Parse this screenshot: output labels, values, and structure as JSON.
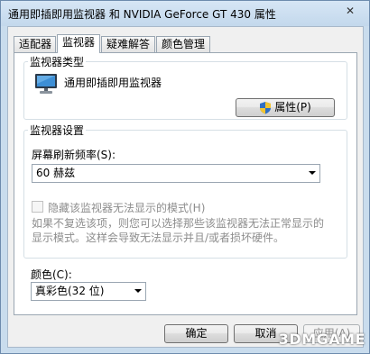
{
  "window": {
    "title": "通用即插即用监视器 和 NVIDIA GeForce GT 430 属性",
    "close_symbol": "✕"
  },
  "tabs": [
    {
      "label": "适配器",
      "active": false
    },
    {
      "label": "监视器",
      "active": true
    },
    {
      "label": "疑难解答",
      "active": false
    },
    {
      "label": "颜色管理",
      "active": false
    }
  ],
  "monitor_type": {
    "group_title": "监视器类型",
    "monitor_name": "通用即插即用监视器",
    "properties_button": "属性(P)"
  },
  "monitor_settings": {
    "group_title": "监视器设置",
    "refresh_label": "屏幕刷新频率(S):",
    "refresh_value": "60 赫兹",
    "hide_modes_label": "隐藏该监视器无法显示的模式(H)",
    "hide_modes_checked": false,
    "hint_line1": "如果不复选该项，则您可以选择那些该监视器无法正常显示的",
    "hint_line2": "显示模式。这样会导致无法显示并且/或者损坏硬件。"
  },
  "color": {
    "label": "颜色(C):",
    "value": "真彩色(32 位)"
  },
  "footer": {
    "ok": "确定",
    "cancel": "取消",
    "apply": "应用(A)"
  },
  "watermark": "3DMGAME"
}
